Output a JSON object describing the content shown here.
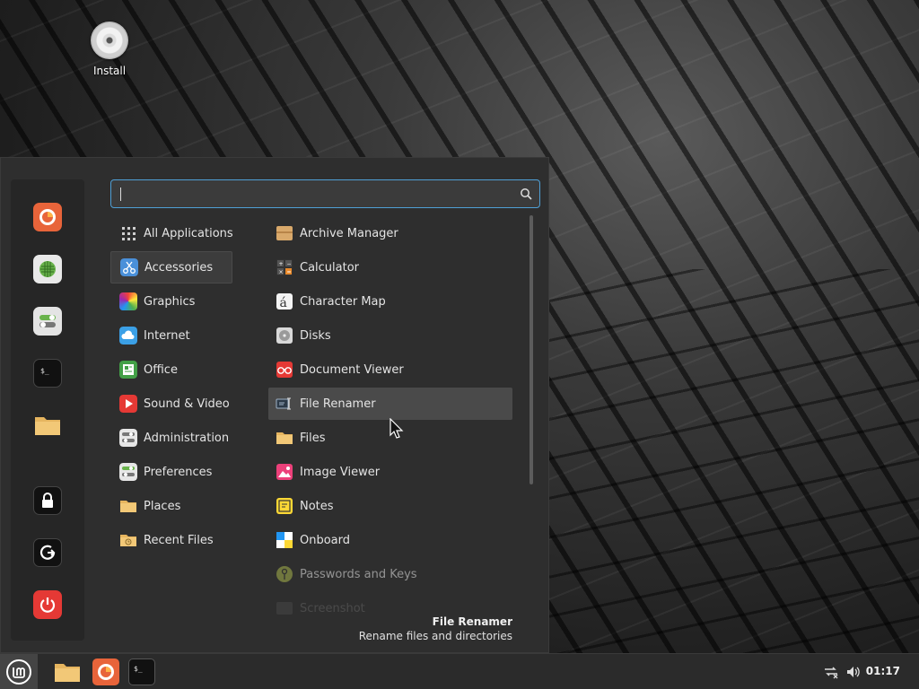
{
  "desktop": {
    "icons": [
      {
        "label": "Install",
        "icon": "disc-icon"
      }
    ]
  },
  "favorites": [
    {
      "name": "firefox",
      "icon": "firefox-icon",
      "color": "#e8643a"
    },
    {
      "name": "software-manager",
      "icon": "software-manager-icon",
      "color": "#69b34c"
    },
    {
      "name": "settings",
      "icon": "toggles-icon",
      "color": "#8a8a8a"
    },
    {
      "name": "terminal",
      "icon": "terminal-icon",
      "color": "#111111"
    },
    {
      "name": "files",
      "icon": "folder-icon",
      "color": "#e6b55f"
    },
    {
      "name": "lock-screen",
      "icon": "lock-icon",
      "color": "#111111"
    },
    {
      "name": "logout",
      "icon": "logout-icon",
      "color": "#111111"
    },
    {
      "name": "shutdown",
      "icon": "power-icon",
      "color": "#e53935"
    }
  ],
  "search": {
    "value": "",
    "placeholder": ""
  },
  "categories": [
    {
      "label": "All Applications",
      "icon": "grid-icon",
      "active": false
    },
    {
      "label": "Accessories",
      "icon": "scissors-icon",
      "active": true
    },
    {
      "label": "Graphics",
      "icon": "graphics-icon",
      "active": false
    },
    {
      "label": "Internet",
      "icon": "cloud-icon",
      "active": false
    },
    {
      "label": "Office",
      "icon": "office-icon",
      "active": false
    },
    {
      "label": "Sound & Video",
      "icon": "play-icon",
      "active": false
    },
    {
      "label": "Administration",
      "icon": "admin-icon",
      "active": false
    },
    {
      "label": "Preferences",
      "icon": "preferences-icon",
      "active": false
    },
    {
      "label": "Places",
      "icon": "folder-icon",
      "active": false
    },
    {
      "label": "Recent Files",
      "icon": "recent-folder-icon",
      "active": false
    }
  ],
  "apps": [
    {
      "label": "Archive Manager",
      "icon": "archive-icon"
    },
    {
      "label": "Calculator",
      "icon": "calculator-icon"
    },
    {
      "label": "Character Map",
      "icon": "character-map-icon"
    },
    {
      "label": "Disks",
      "icon": "disks-icon"
    },
    {
      "label": "Document Viewer",
      "icon": "glasses-icon"
    },
    {
      "label": "File Renamer",
      "icon": "file-renamer-icon",
      "hover": true
    },
    {
      "label": "Files",
      "icon": "folder-icon"
    },
    {
      "label": "Image Viewer",
      "icon": "image-viewer-icon"
    },
    {
      "label": "Notes",
      "icon": "notes-icon"
    },
    {
      "label": "Onboard",
      "icon": "onboard-icon"
    },
    {
      "label": "Passwords and Keys",
      "icon": "keys-icon",
      "faded": true
    },
    {
      "label": "Screenshot",
      "icon": "screenshot-icon",
      "faded2": true
    }
  ],
  "description": {
    "title": "File Renamer",
    "subtitle": "Rename files and directories"
  },
  "panel": {
    "clock": "01:17",
    "apps": [
      {
        "name": "files",
        "icon": "folder-icon"
      },
      {
        "name": "firefox",
        "icon": "firefox-icon"
      },
      {
        "name": "terminal",
        "icon": "terminal-icon"
      }
    ]
  }
}
